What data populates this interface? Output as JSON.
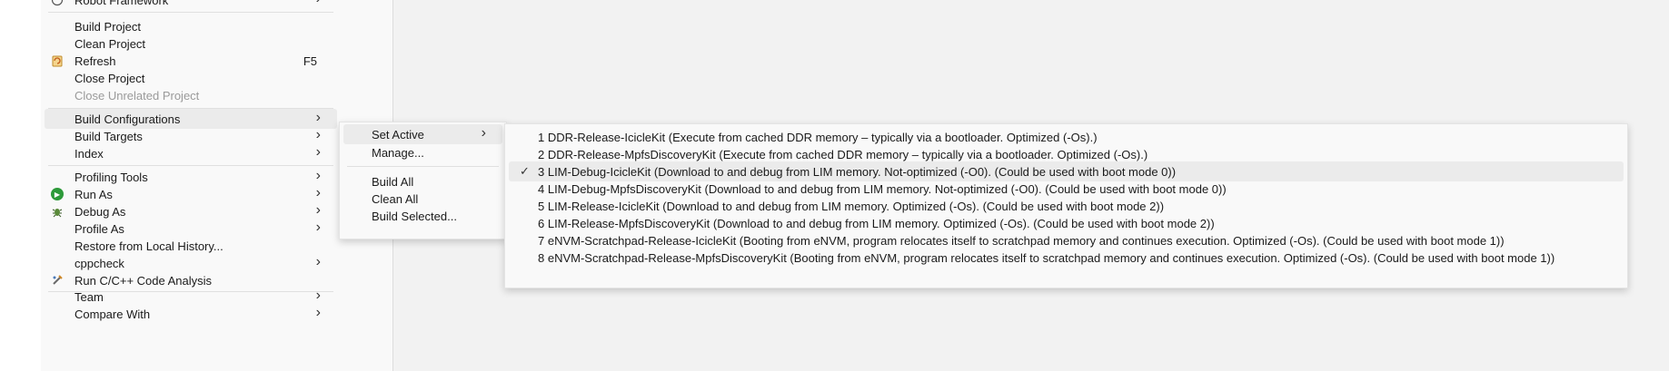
{
  "main_menu": {
    "items": [
      {
        "label": "Robot Framework",
        "has_submenu": true,
        "icon": "robot-icon"
      },
      {
        "label": "Build Project"
      },
      {
        "label": "Clean Project"
      },
      {
        "label": "Refresh",
        "shortcut": "F5",
        "icon": "refresh-icon"
      },
      {
        "label": "Close Project"
      },
      {
        "label": "Close Unrelated Project",
        "disabled": true
      },
      {
        "label": "Build Configurations",
        "has_submenu": true,
        "highlighted": true
      },
      {
        "label": "Build Targets",
        "has_submenu": true
      },
      {
        "label": "Index",
        "has_submenu": true
      },
      {
        "label": "Profiling Tools",
        "has_submenu": true
      },
      {
        "label": "Run As",
        "has_submenu": true,
        "icon": "run-icon"
      },
      {
        "label": "Debug As",
        "has_submenu": true,
        "icon": "bug-icon"
      },
      {
        "label": "Profile As",
        "has_submenu": true
      },
      {
        "label": "Restore from Local History..."
      },
      {
        "label": "cppcheck",
        "has_submenu": true
      },
      {
        "label": "Run C/C++ Code Analysis",
        "icon": "code-analysis-icon"
      },
      {
        "label": "Team",
        "has_submenu": true
      },
      {
        "label": "Compare With",
        "has_submenu": true
      }
    ]
  },
  "build_config_menu": {
    "items": [
      {
        "label": "Set Active",
        "has_submenu": true,
        "highlighted": true
      },
      {
        "label": "Manage..."
      },
      {
        "label": "Build All"
      },
      {
        "label": "Clean All"
      },
      {
        "label": "Build Selected..."
      }
    ]
  },
  "set_active_menu": {
    "items": [
      {
        "label": "1 DDR-Release-IcicleKit (Execute from cached DDR memory – typically via a bootloader. Optimized (-Os).)"
      },
      {
        "label": "2 DDR-Release-MpfsDiscoveryKit (Execute from cached DDR memory – typically via a bootloader. Optimized (-Os).)"
      },
      {
        "label": "3 LIM-Debug-IcicleKit (Download to and debug from LIM memory. Not-optimized (-O0). (Could be used with boot mode 0))",
        "checked": true,
        "highlighted": true
      },
      {
        "label": "4 LIM-Debug-MpfsDiscoveryKit (Download to and debug from LIM memory. Not-optimized (-O0). (Could be used with boot mode 0))"
      },
      {
        "label": "5 LIM-Release-IcicleKit (Download to and debug from LIM memory. Optimized (-Os). (Could be used with boot mode 2))"
      },
      {
        "label": "6 LIM-Release-MpfsDiscoveryKit (Download to and debug from LIM memory. Optimized (-Os). (Could be used with boot mode 2))"
      },
      {
        "label": "7 eNVM-Scratchpad-Release-IcicleKit (Booting from eNVM, program relocates itself to scratchpad memory and continues execution. Optimized (-Os). (Could be used with boot mode 1))"
      },
      {
        "label": "8 eNVM-Scratchpad-Release-MpfsDiscoveryKit (Booting from eNVM, program relocates itself to scratchpad memory and continues execution. Optimized (-Os). (Could be used with boot mode 1))"
      }
    ]
  },
  "glyphs": {
    "submenu_arrow": "›",
    "check": "✓"
  },
  "colors": {
    "menu_bg": "#f9f9f9",
    "highlight": "#ebebeb",
    "disabled_text": "#9a9a9a",
    "editor_bg": "#f2f2f2"
  }
}
